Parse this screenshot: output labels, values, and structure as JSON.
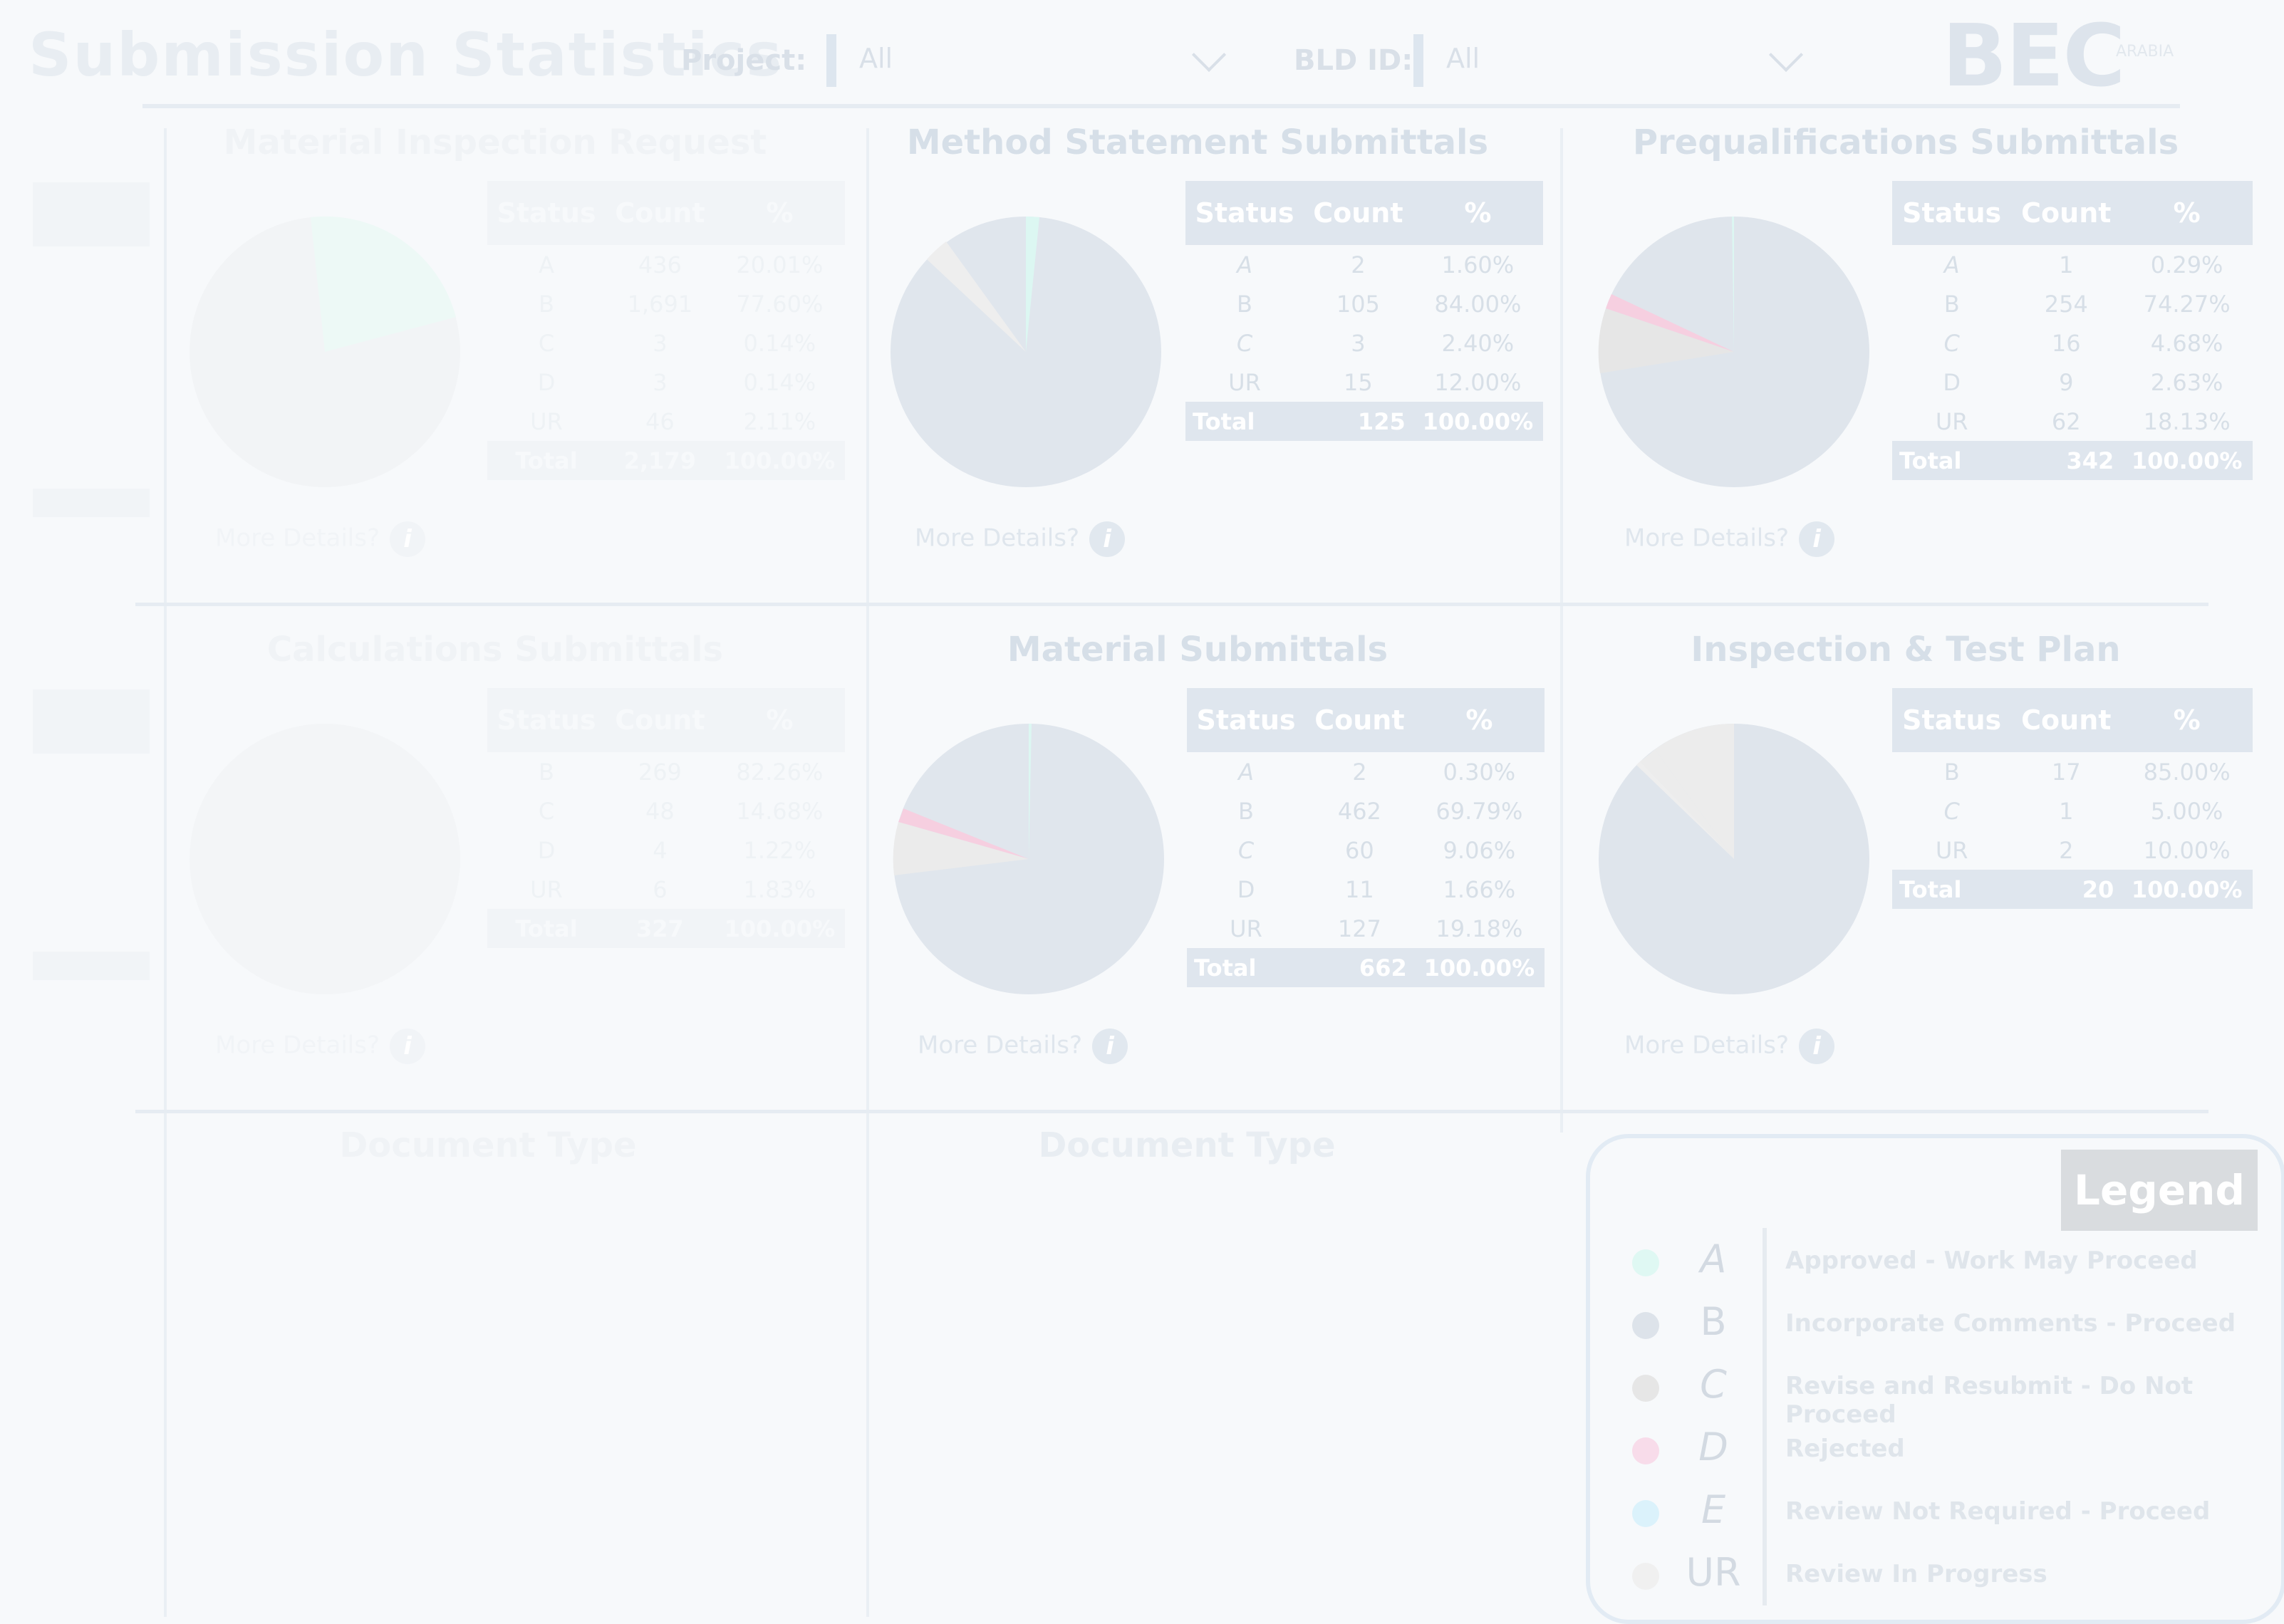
{
  "header": {
    "title": "Submission Statistics",
    "project_label": "Project:",
    "project_value": "All",
    "bld_label": "BLD ID:",
    "bld_value": "All",
    "logo_text": "BEC",
    "logo_sub": "ARABIA"
  },
  "table_headers": {
    "status": "Status",
    "count": "Count",
    "pct": "%"
  },
  "more_details": "More Details?",
  "info_glyph": "i",
  "panels": [
    {
      "title": "Material Inspection Request",
      "rows": [
        {
          "status": "A",
          "count": "436",
          "pct": "20.01%"
        },
        {
          "status": "B",
          "count": "1,691",
          "pct": "77.60%"
        },
        {
          "status": "C",
          "count": "3",
          "pct": "0.14%"
        },
        {
          "status": "D",
          "count": "3",
          "pct": "0.14%"
        },
        {
          "status": "UR",
          "count": "46",
          "pct": "2.11%"
        }
      ],
      "total": {
        "label": "Total",
        "count": "2,179",
        "pct": "100.00%"
      }
    },
    {
      "title": "Method Statement Submittals",
      "rows": [
        {
          "status": "A",
          "count": "2",
          "pct": "1.60%"
        },
        {
          "status": "B",
          "count": "105",
          "pct": "84.00%"
        },
        {
          "status": "C",
          "count": "3",
          "pct": "2.40%"
        },
        {
          "status": "UR",
          "count": "15",
          "pct": "12.00%"
        }
      ],
      "total": {
        "label": "Total",
        "count": "125",
        "pct": "100.00%"
      }
    },
    {
      "title": "Prequalifications Submittals",
      "rows": [
        {
          "status": "A",
          "count": "1",
          "pct": "0.29%"
        },
        {
          "status": "B",
          "count": "254",
          "pct": "74.27%"
        },
        {
          "status": "C",
          "count": "16",
          "pct": "4.68%"
        },
        {
          "status": "D",
          "count": "9",
          "pct": "2.63%"
        },
        {
          "status": "UR",
          "count": "62",
          "pct": "18.13%"
        }
      ],
      "total": {
        "label": "Total",
        "count": "342",
        "pct": "100.00%"
      }
    },
    {
      "title": "Calculations Submittals",
      "rows": [
        {
          "status": "B",
          "count": "269",
          "pct": "82.26%"
        },
        {
          "status": "C",
          "count": "48",
          "pct": "14.68%"
        },
        {
          "status": "D",
          "count": "4",
          "pct": "1.22%"
        },
        {
          "status": "UR",
          "count": "6",
          "pct": "1.83%"
        }
      ],
      "total": {
        "label": "Total",
        "count": "327",
        "pct": "100.00%"
      }
    },
    {
      "title": "Material Submittals",
      "rows": [
        {
          "status": "A",
          "count": "2",
          "pct": "0.30%"
        },
        {
          "status": "B",
          "count": "462",
          "pct": "69.79%"
        },
        {
          "status": "C",
          "count": "60",
          "pct": "9.06%"
        },
        {
          "status": "D",
          "count": "11",
          "pct": "1.66%"
        },
        {
          "status": "UR",
          "count": "127",
          "pct": "19.18%"
        }
      ],
      "total": {
        "label": "Total",
        "count": "662",
        "pct": "100.00%"
      }
    },
    {
      "title": "Inspection & Test Plan",
      "rows": [
        {
          "status": "B",
          "count": "17",
          "pct": "85.00%"
        },
        {
          "status": "C",
          "count": "1",
          "pct": "5.00%"
        },
        {
          "status": "UR",
          "count": "2",
          "pct": "10.00%"
        }
      ],
      "total": {
        "label": "Total",
        "count": "20",
        "pct": "100.00%"
      }
    }
  ],
  "doc_type_1": "Document Type",
  "doc_type_2": "Document Type",
  "legend": {
    "title": "Legend",
    "items": [
      {
        "code": "A",
        "desc": "Approved - Work May Proceed",
        "color": "#dff8f3"
      },
      {
        "code": "B",
        "desc": "Incorporate Comments - Proceed",
        "color": "#dde3ea"
      },
      {
        "code": "C",
        "desc": "Revise and Resubmit - Do Not Proceed",
        "color": "#e6e6e6"
      },
      {
        "code": "D",
        "desc": "Rejected",
        "color": "#f8dcea"
      },
      {
        "code": "E",
        "desc": "Review Not Required - Proceed",
        "color": "#dbf2fb"
      },
      {
        "code": "UR",
        "desc": "Review In Progress",
        "color": "#f0f0f0"
      }
    ]
  },
  "colors": {
    "A": "#dff8f3",
    "B": "#dfe5ec",
    "C": "#eaeaea",
    "D": "#f6cfe0",
    "UR": "#efefef"
  }
}
